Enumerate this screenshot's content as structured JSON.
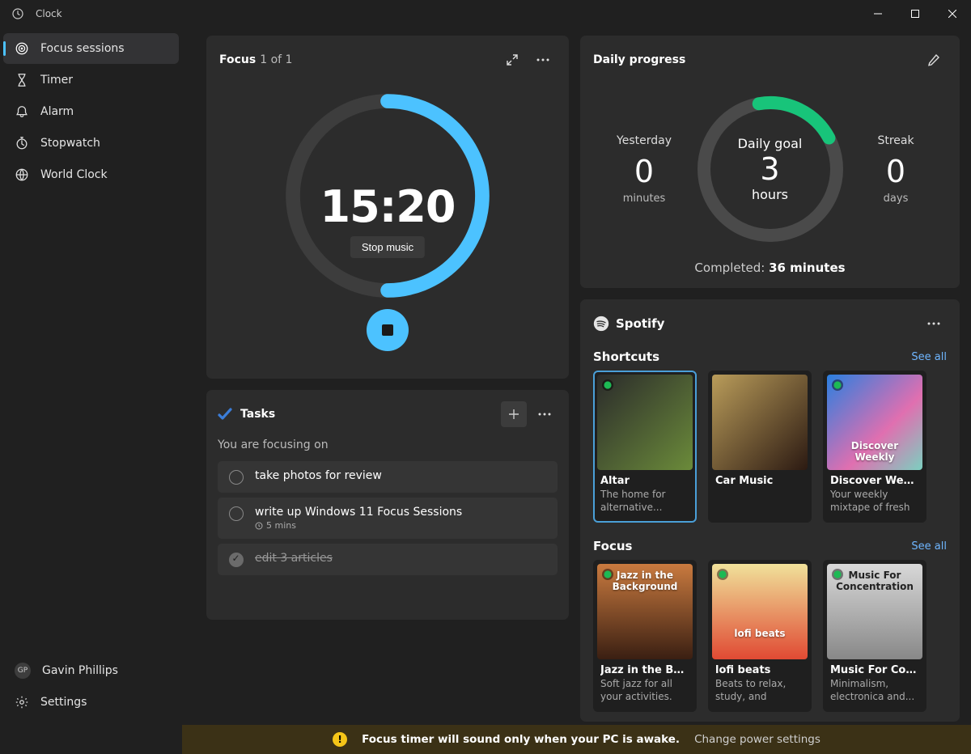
{
  "app": {
    "title": "Clock"
  },
  "window": {
    "minimize": "–",
    "maximize": "▢",
    "close": "✕"
  },
  "sidebar": {
    "items": [
      {
        "label": "Focus sessions"
      },
      {
        "label": "Timer"
      },
      {
        "label": "Alarm"
      },
      {
        "label": "Stopwatch"
      },
      {
        "label": "World Clock"
      }
    ],
    "user": {
      "initials": "GP",
      "name": "Gavin Phillips"
    },
    "settings": "Settings"
  },
  "focus": {
    "title": "Focus",
    "counter": "1 of 1",
    "timer": "15:20",
    "stop_music_label": "Stop music"
  },
  "progress": {
    "title": "Daily progress",
    "yesterday": {
      "label": "Yesterday",
      "value": "0",
      "unit": "minutes"
    },
    "goal": {
      "label": "Daily goal",
      "value": "3",
      "unit": "hours"
    },
    "streak": {
      "label": "Streak",
      "value": "0",
      "unit": "days"
    },
    "completed_prefix": "Completed: ",
    "completed_value": "36 minutes"
  },
  "tasks": {
    "title": "Tasks",
    "focusing_on": "You are focusing on",
    "items": [
      {
        "text": "take photos for review",
        "done": false
      },
      {
        "text": "write up Windows 11 Focus Sessions",
        "done": false,
        "meta": "5 mins"
      },
      {
        "text": "edit 3 articles",
        "done": true
      }
    ]
  },
  "spotify": {
    "brand": "Spotify",
    "shortcuts_title": "Shortcuts",
    "focus_title": "Focus",
    "see_all": "See all",
    "shortcuts": [
      {
        "name": "Altar",
        "desc": "The home for alternative...",
        "art_label": ""
      },
      {
        "name": "Car Music",
        "desc": "",
        "art_label": ""
      },
      {
        "name": "Discover Weekly",
        "desc": "Your weekly mixtape of fresh music. Enj...",
        "art_label": "Discover Weekly"
      }
    ],
    "focus": [
      {
        "name": "Jazz in the Backg...",
        "desc": "Soft jazz for all your activities.",
        "art_label": "Jazz in the Background"
      },
      {
        "name": "lofi beats",
        "desc": "Beats to relax, study, and focus...",
        "art_label": "lofi beats"
      },
      {
        "name": "Music For Conce...",
        "desc": "Minimalism, electronica and...",
        "art_label": "Music For Concentration"
      }
    ]
  },
  "alert": {
    "message": "Focus timer will sound only when your PC is awake.",
    "link": "Change power settings"
  }
}
